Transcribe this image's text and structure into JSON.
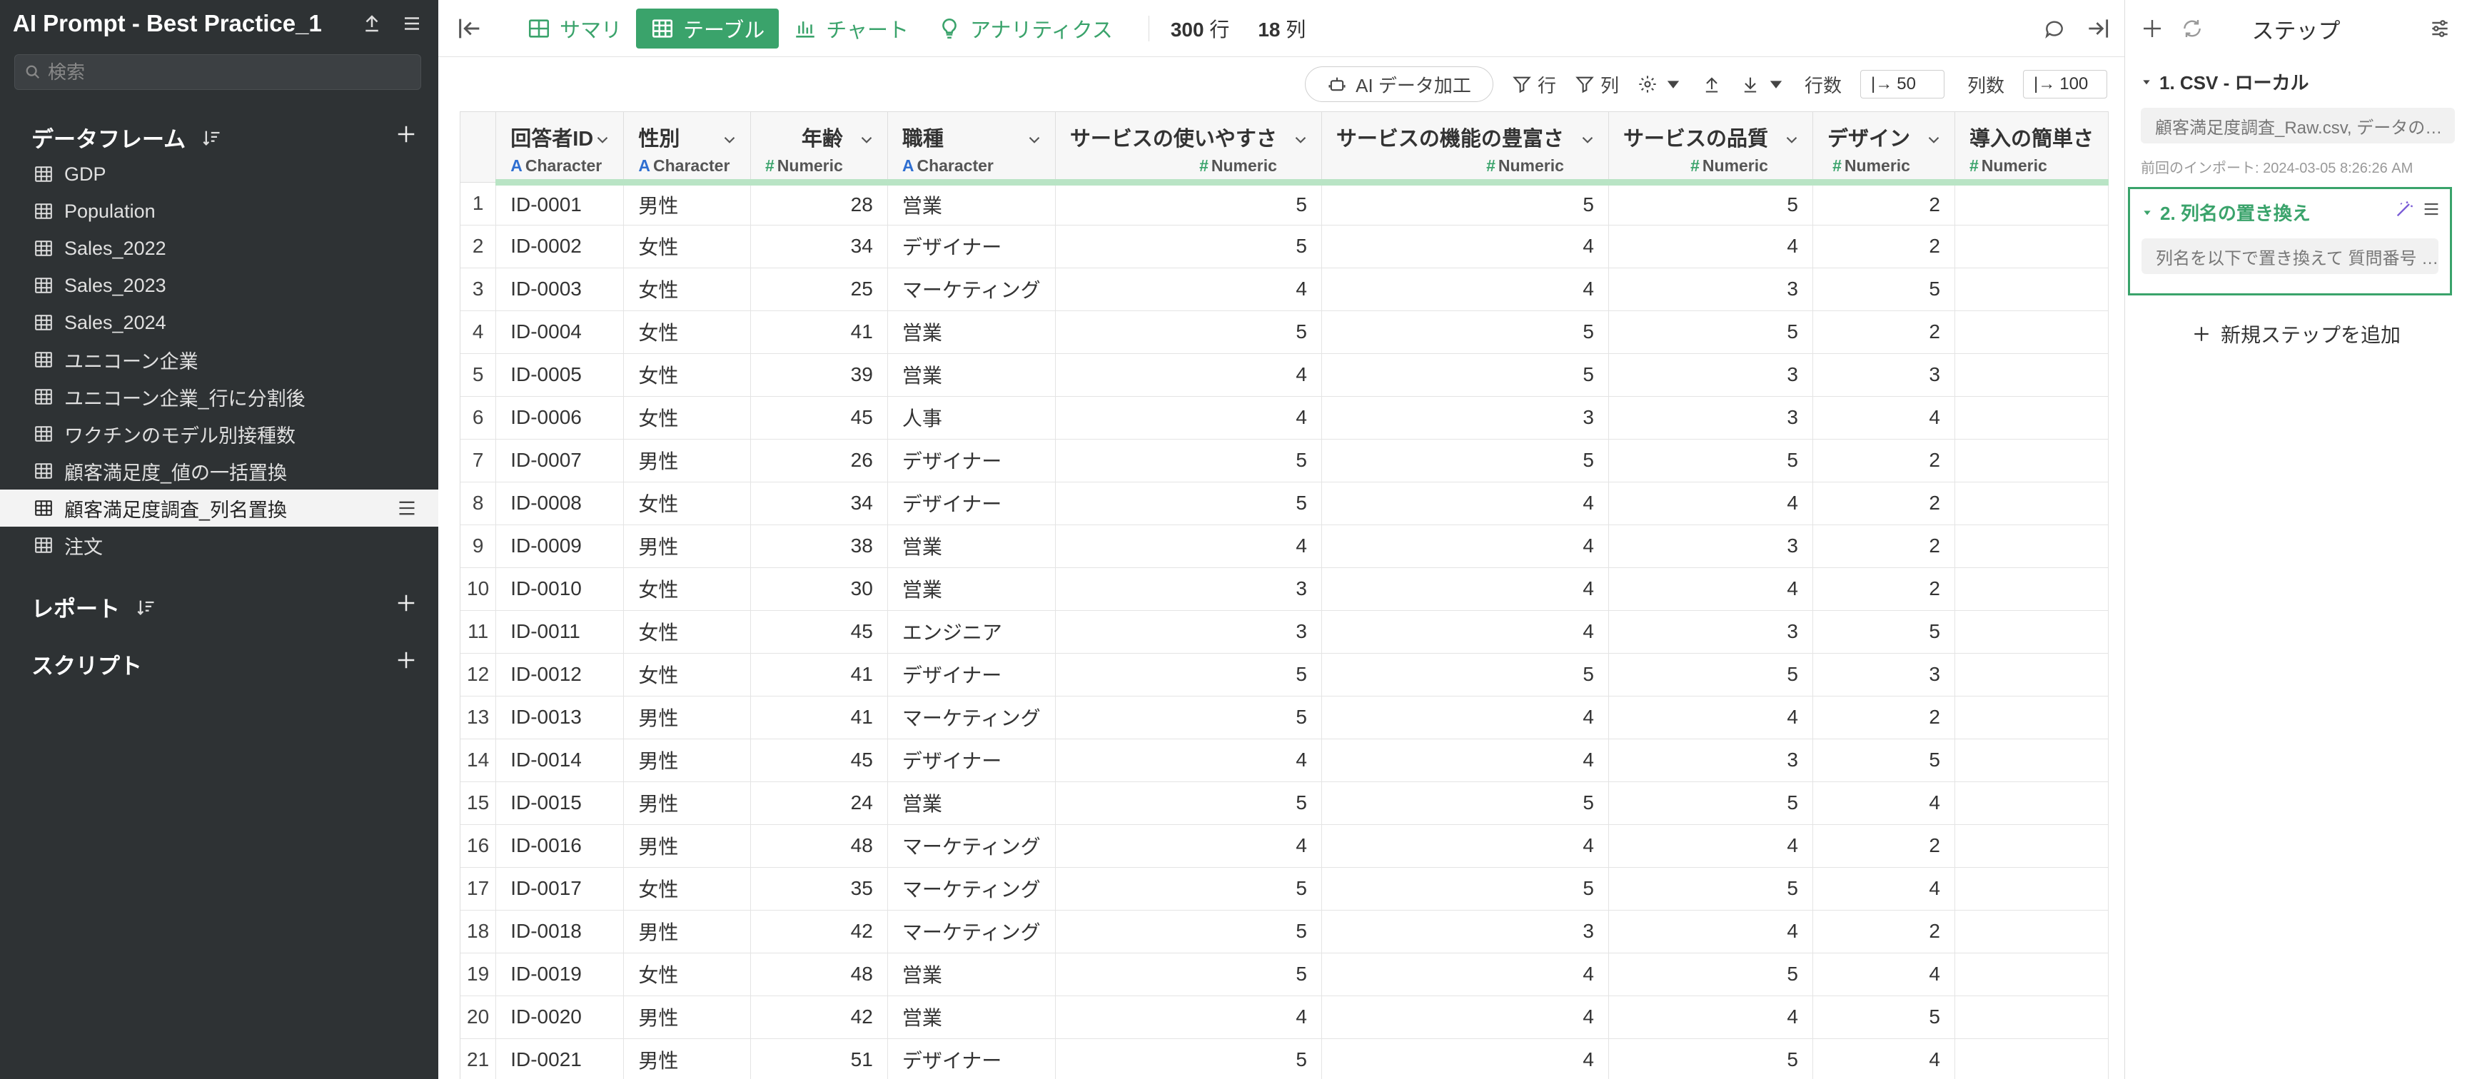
{
  "sidebar": {
    "project_title": "AI Prompt - Best Practice_1",
    "search_placeholder": "検索",
    "sections": {
      "dataframes": "データフレーム",
      "reports": "レポート",
      "scripts": "スクリプト"
    },
    "dataframes": [
      "GDP",
      "Population",
      "Sales_2022",
      "Sales_2023",
      "Sales_2024",
      "ユニコーン企業",
      "ユニコーン企業_行に分割後",
      "ワクチンのモデル別接種数",
      "顧客満足度_値の一括置換",
      "顧客満足度調査_列名置換",
      "注文"
    ],
    "active_dataframe": "顧客満足度調査_列名置換"
  },
  "toolbar": {
    "summary": "サマリ",
    "table": "テーブル",
    "chart": "チャート",
    "analytics": "アナリティクス",
    "rows_count": "300",
    "rows_unit": "行",
    "cols_count": "18",
    "cols_unit": "列"
  },
  "subbar": {
    "ai_label": "AI データ加工",
    "row_filter": "行",
    "col_filter": "列",
    "rows_label": "行数",
    "rows_value": "50",
    "cols_label": "列数",
    "cols_value": "100"
  },
  "table": {
    "columns": [
      {
        "name": "回答者ID",
        "type": "Character",
        "sym": "A"
      },
      {
        "name": "性別",
        "type": "Character",
        "sym": "A"
      },
      {
        "name": "年齢",
        "type": "Numeric",
        "sym": "#"
      },
      {
        "name": "職種",
        "type": "Character",
        "sym": "A"
      },
      {
        "name": "サービスの使いやすさ",
        "type": "Numeric",
        "sym": "#"
      },
      {
        "name": "サービスの機能の豊富さ",
        "type": "Numeric",
        "sym": "#"
      },
      {
        "name": "サービスの品質",
        "type": "Numeric",
        "sym": "#"
      },
      {
        "name": "デザイン",
        "type": "Numeric",
        "sym": "#"
      },
      {
        "name": "導入の簡単さ",
        "type": "Numeric",
        "sym": "#"
      }
    ],
    "rows": [
      [
        "1",
        "ID-0001",
        "男性",
        "28",
        "営業",
        "5",
        "5",
        "5",
        "2",
        ""
      ],
      [
        "2",
        "ID-0002",
        "女性",
        "34",
        "デザイナー",
        "5",
        "4",
        "4",
        "2",
        ""
      ],
      [
        "3",
        "ID-0003",
        "女性",
        "25",
        "マーケティング",
        "4",
        "4",
        "3",
        "5",
        ""
      ],
      [
        "4",
        "ID-0004",
        "女性",
        "41",
        "営業",
        "5",
        "5",
        "5",
        "2",
        ""
      ],
      [
        "5",
        "ID-0005",
        "女性",
        "39",
        "営業",
        "4",
        "5",
        "3",
        "3",
        ""
      ],
      [
        "6",
        "ID-0006",
        "女性",
        "45",
        "人事",
        "4",
        "3",
        "3",
        "4",
        ""
      ],
      [
        "7",
        "ID-0007",
        "男性",
        "26",
        "デザイナー",
        "5",
        "5",
        "5",
        "2",
        ""
      ],
      [
        "8",
        "ID-0008",
        "女性",
        "34",
        "デザイナー",
        "5",
        "4",
        "4",
        "2",
        ""
      ],
      [
        "9",
        "ID-0009",
        "男性",
        "38",
        "営業",
        "4",
        "4",
        "3",
        "2",
        ""
      ],
      [
        "10",
        "ID-0010",
        "女性",
        "30",
        "営業",
        "3",
        "4",
        "4",
        "2",
        ""
      ],
      [
        "11",
        "ID-0011",
        "女性",
        "45",
        "エンジニア",
        "3",
        "4",
        "3",
        "5",
        ""
      ],
      [
        "12",
        "ID-0012",
        "女性",
        "41",
        "デザイナー",
        "5",
        "5",
        "5",
        "3",
        ""
      ],
      [
        "13",
        "ID-0013",
        "男性",
        "41",
        "マーケティング",
        "5",
        "4",
        "4",
        "2",
        ""
      ],
      [
        "14",
        "ID-0014",
        "男性",
        "45",
        "デザイナー",
        "4",
        "4",
        "3",
        "5",
        ""
      ],
      [
        "15",
        "ID-0015",
        "男性",
        "24",
        "営業",
        "5",
        "5",
        "5",
        "4",
        ""
      ],
      [
        "16",
        "ID-0016",
        "男性",
        "48",
        "マーケティング",
        "4",
        "4",
        "4",
        "2",
        ""
      ],
      [
        "17",
        "ID-0017",
        "女性",
        "35",
        "マーケティング",
        "5",
        "5",
        "5",
        "4",
        ""
      ],
      [
        "18",
        "ID-0018",
        "男性",
        "42",
        "マーケティング",
        "5",
        "3",
        "4",
        "2",
        ""
      ],
      [
        "19",
        "ID-0019",
        "女性",
        "48",
        "営業",
        "5",
        "4",
        "5",
        "4",
        ""
      ],
      [
        "20",
        "ID-0020",
        "男性",
        "42",
        "営業",
        "4",
        "4",
        "4",
        "5",
        ""
      ],
      [
        "21",
        "ID-0021",
        "男性",
        "51",
        "デザイナー",
        "5",
        "4",
        "5",
        "4",
        ""
      ]
    ]
  },
  "steps": {
    "title": "ステップ",
    "step1_title": "1. CSV - ローカル",
    "step1_desc": "顧客満足度調査_Raw.csv, データの…",
    "step1_import": "前回のインポート: 2024-03-05 8:26:26 AM",
    "step2_title": "2. 列名の置き換え",
    "step2_desc": "列名を以下で置き換えて 質問番号 …",
    "add_step": "新規ステップを追加"
  },
  "colors": {
    "accent": "#3aa36b",
    "sidebar_bg": "#2e3234",
    "header_underline": "#b9e4c5",
    "char_type": "#2f6fd1"
  }
}
